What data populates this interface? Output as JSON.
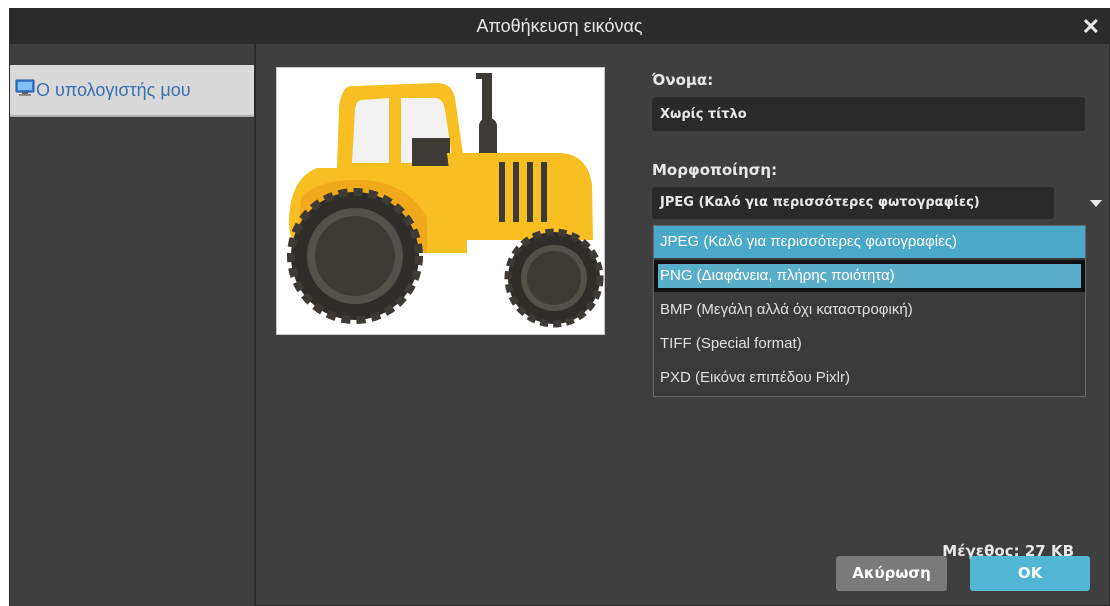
{
  "dialog": {
    "title": "Αποθήκευση εικόνας",
    "close_label": "✕"
  },
  "sidebar": {
    "items": [
      {
        "label": "Ο υπολογιστής μου",
        "icon": "computer-icon"
      }
    ]
  },
  "form": {
    "name_label": "Όνομα:",
    "name_value": "Χωρίς τίτλο",
    "format_label": "Μορφοποίηση:",
    "format_selected": "JPEG (Καλό για περισσότερες φωτογραφίες)",
    "format_options": [
      "JPEG (Καλό για περισσότερες φωτογραφίες)",
      "PNG (Διαφάνεια, πλήρης ποιότητα)",
      "BMP (Μεγάλη αλλά όχι καταστροφική)",
      "TIFF (Special format)",
      "PXD (Εικόνα επιπέδου Pixlr)"
    ],
    "size_text": "Μέγεθος: 27 KB"
  },
  "buttons": {
    "cancel": "Ακύρωση",
    "ok": "OK"
  },
  "colors": {
    "accent": "#52b7d4",
    "selected_option": "#4aa8c9",
    "dialog_bg": "#3f3f3f",
    "titlebar_bg": "#2b2b2b"
  }
}
